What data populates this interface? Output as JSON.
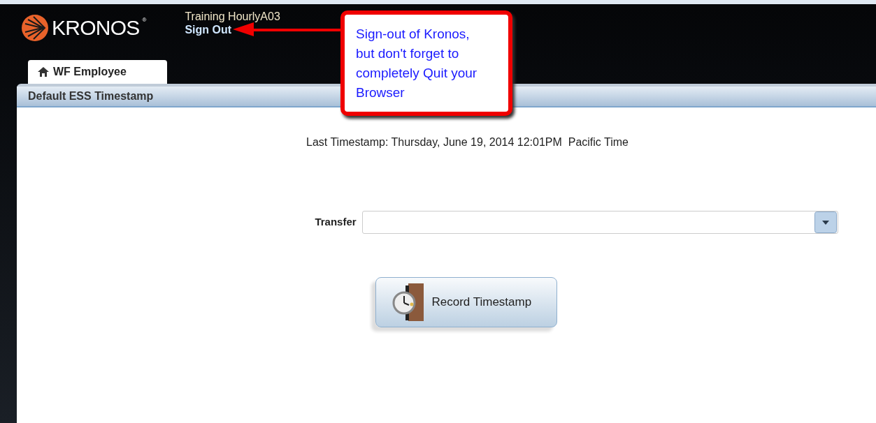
{
  "header": {
    "logo_text": "KRONOS",
    "logo_mark": "®",
    "user_name": "Training HourlyA03",
    "sign_out": "Sign Out"
  },
  "tabs": [
    {
      "label": "WF Employee",
      "selected": true
    }
  ],
  "panel": {
    "title": "Default ESS Timestamp",
    "last_timestamp": "Last Timestamp: Thursday, June 19, 2014 12:01PM  Pacific Time",
    "transfer_label": "Transfer",
    "record_button": "Record Timestamp"
  },
  "callout": {
    "text": "Sign-out of Kronos, but don't forget to completely Quit your Browser"
  }
}
